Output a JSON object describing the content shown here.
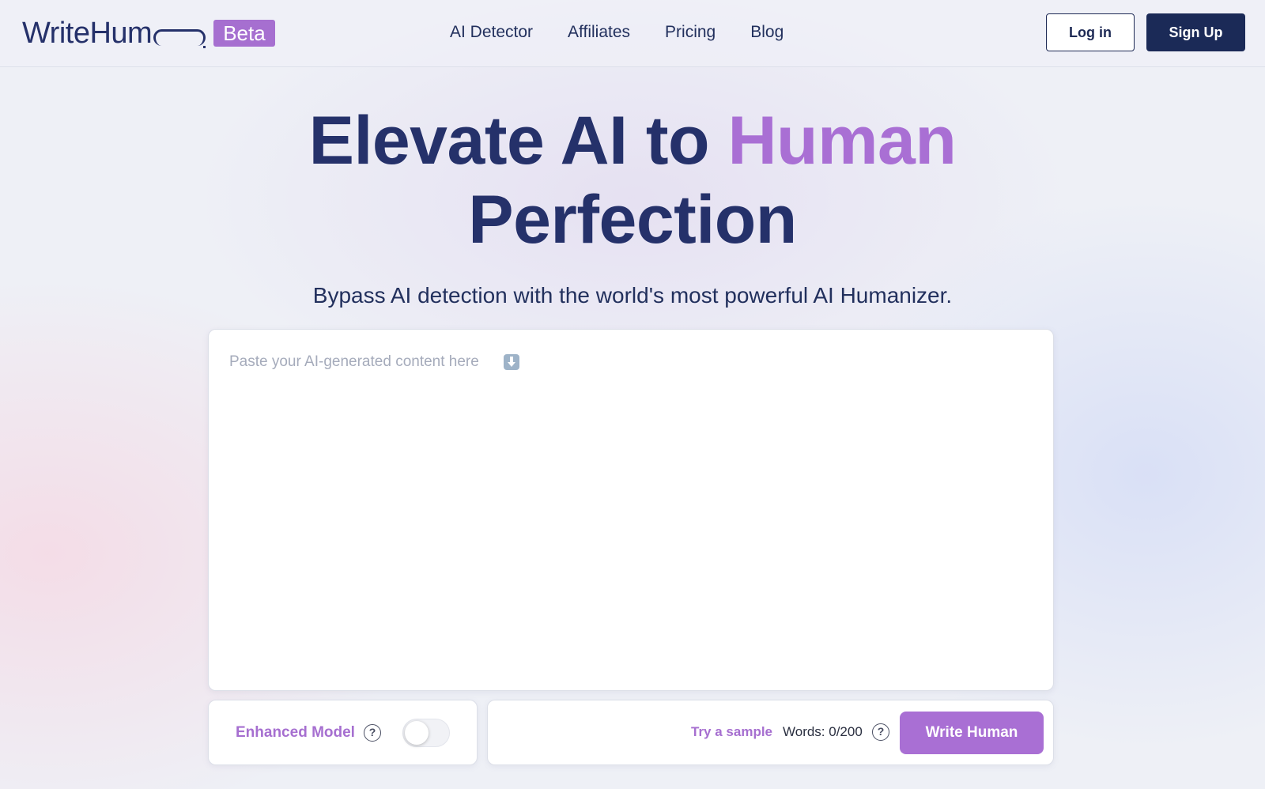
{
  "brand": {
    "logo_text": "WriteHum",
    "badge": "Beta",
    "colors": {
      "navy": "#1b2a57",
      "purple": "#a96fd4"
    }
  },
  "nav": {
    "items": [
      {
        "label": "AI Detector"
      },
      {
        "label": "Affiliates"
      },
      {
        "label": "Pricing"
      },
      {
        "label": "Blog"
      }
    ],
    "login_label": "Log in",
    "signup_label": "Sign Up"
  },
  "hero": {
    "title_part1": "Elevate AI to ",
    "title_accent": "Human",
    "title_part2": "Perfection",
    "subtitle": "Bypass AI detection with the world's most powerful AI Humanizer."
  },
  "editor": {
    "placeholder": "Paste your AI-generated content here",
    "placeholder_icon": "down-arrow-icon",
    "value": ""
  },
  "options": {
    "enhanced_label": "Enhanced Model",
    "enhanced_enabled": false,
    "help_icon": "question-circle-icon",
    "help_glyph": "?"
  },
  "actions": {
    "try_sample": "Try a sample",
    "words": "Words: 0/200",
    "submit_label": "Write Human"
  }
}
